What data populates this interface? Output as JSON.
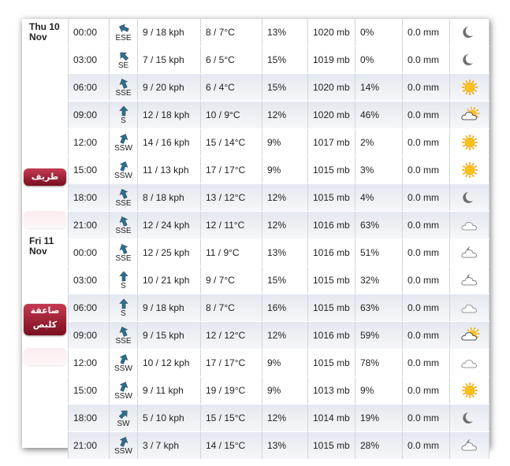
{
  "days": [
    {
      "label_line1": "Thu 10",
      "label_line2": "Nov",
      "sticker_text": "طريف"
    },
    {
      "label_line1": "Fri 11",
      "label_line2": "Nov",
      "sticker_text": "صاعقة كلبص"
    }
  ],
  "rows": [
    {
      "time": "00:00",
      "dir": "ESE",
      "speed": "9 / 18 kph",
      "temp": "8 / 7°C",
      "hum": "13%",
      "pres": "1020 mb",
      "prob": "0%",
      "prec": "0.0 mm",
      "icon": "moon-icon"
    },
    {
      "time": "03:00",
      "dir": "SE",
      "speed": "7 / 15 kph",
      "temp": "6 / 5°C",
      "hum": "15%",
      "pres": "1019 mb",
      "prob": "0%",
      "prec": "0.0 mm",
      "icon": "moon-icon"
    },
    {
      "time": "06:00",
      "dir": "SSE",
      "speed": "9 / 20 kph",
      "temp": "6 / 4°C",
      "hum": "15%",
      "pres": "1020 mb",
      "prob": "14%",
      "prec": "0.0 mm",
      "icon": "sun-icon"
    },
    {
      "time": "09:00",
      "dir": "S",
      "speed": "12 / 18 kph",
      "temp": "10 / 9°C",
      "hum": "12%",
      "pres": "1020 mb",
      "prob": "46%",
      "prec": "0.0 mm",
      "icon": "sun-cloud-icon"
    },
    {
      "time": "12:00",
      "dir": "SSW",
      "speed": "14 / 16 kph",
      "temp": "15 / 14°C",
      "hum": "9%",
      "pres": "1017 mb",
      "prob": "2%",
      "prec": "0.0 mm",
      "icon": "sun-icon"
    },
    {
      "time": "15:00",
      "dir": "SSW",
      "speed": "11 / 13 kph",
      "temp": "17 / 17°C",
      "hum": "9%",
      "pres": "1015 mb",
      "prob": "3%",
      "prec": "0.0 mm",
      "icon": "sun-icon"
    },
    {
      "time": "18:00",
      "dir": "SSE",
      "speed": "8 / 18 kph",
      "temp": "13 / 12°C",
      "hum": "12%",
      "pres": "1015 mb",
      "prob": "4%",
      "prec": "0.0 mm",
      "icon": "moon-icon"
    },
    {
      "time": "21:00",
      "dir": "SSE",
      "speed": "12 / 24 kph",
      "temp": "12 / 11°C",
      "hum": "12%",
      "pres": "1016 mb",
      "prob": "63%",
      "prec": "0.0 mm",
      "icon": "cloud-icon"
    },
    {
      "time": "00:00",
      "dir": "SSE",
      "speed": "12 / 25 kph",
      "temp": "11 / 9°C",
      "hum": "13%",
      "pres": "1016 mb",
      "prob": "51%",
      "prec": "0.0 mm",
      "icon": "moon-cloud-icon"
    },
    {
      "time": "03:00",
      "dir": "S",
      "speed": "10 / 21 kph",
      "temp": "9 / 7°C",
      "hum": "15%",
      "pres": "1015 mb",
      "prob": "32%",
      "prec": "0.0 mm",
      "icon": "moon-cloud-icon"
    },
    {
      "time": "06:00",
      "dir": "S",
      "speed": "9 / 18 kph",
      "temp": "8 / 7°C",
      "hum": "16%",
      "pres": "1015 mb",
      "prob": "63%",
      "prec": "0.0 mm",
      "icon": "cloud-icon"
    },
    {
      "time": "09:00",
      "dir": "SSE",
      "speed": "9 / 15 kph",
      "temp": "12 / 12°C",
      "hum": "12%",
      "pres": "1016 mb",
      "prob": "59%",
      "prec": "0.0 mm",
      "icon": "sun-cloud-icon"
    },
    {
      "time": "12:00",
      "dir": "SSW",
      "speed": "10 / 12 kph",
      "temp": "17 / 17°C",
      "hum": "9%",
      "pres": "1015 mb",
      "prob": "78%",
      "prec": "0.0 mm",
      "icon": "cloud-icon"
    },
    {
      "time": "15:00",
      "dir": "SSW",
      "speed": "9 / 11 kph",
      "temp": "19 / 19°C",
      "hum": "9%",
      "pres": "1013 mb",
      "prob": "9%",
      "prec": "0.0 mm",
      "icon": "sun-icon"
    },
    {
      "time": "18:00",
      "dir": "SW",
      "speed": "5 / 10 kph",
      "temp": "15 / 15°C",
      "hum": "12%",
      "pres": "1014 mb",
      "prob": "19%",
      "prec": "0.0 mm",
      "icon": "moon-icon"
    },
    {
      "time": "21:00",
      "dir": "SSW",
      "speed": "3 / 7 kph",
      "temp": "14 / 15°C",
      "hum": "13%",
      "pres": "1015 mb",
      "prob": "28%",
      "prec": "0.0 mm",
      "icon": "moon-cloud-icon"
    }
  ]
}
